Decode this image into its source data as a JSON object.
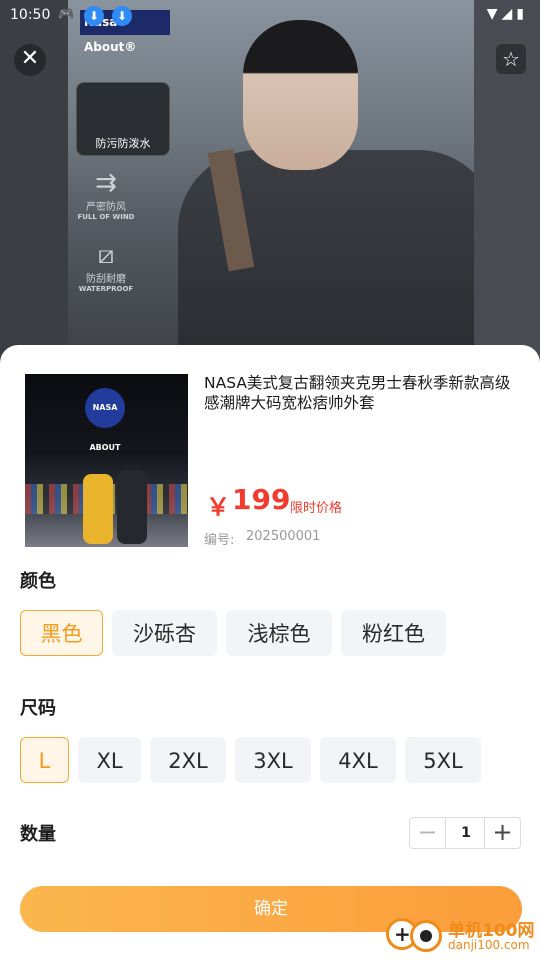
{
  "status_bar": {
    "time": "10:50",
    "right_icons": "▼◢▮"
  },
  "background": {
    "logo_text": "Nasa About®",
    "feature_card": "防污防泼水",
    "features": [
      {
        "icon": "wind-icon",
        "cn": "严密防风",
        "en": "FULL OF WIND"
      },
      {
        "icon": "scratch-icon",
        "cn": "防刮耐磨",
        "en": "WATERPROOF"
      }
    ]
  },
  "product": {
    "thumbnail_badge": "NASA ABOUT",
    "title": "NASA美式复古翻领夹克男士春秋季新款高级感潮牌大码宽松痞帅外套",
    "price_symbol": "￥",
    "price": "199",
    "price_tag": "限时价格",
    "code_label": "编号:",
    "code_value": "202500001"
  },
  "color_section": {
    "title": "颜色",
    "options": [
      "黑色",
      "沙砾杏",
      "浅棕色",
      "粉红色"
    ],
    "selected": "黑色"
  },
  "size_section": {
    "title": "尺码",
    "options": [
      "L",
      "XL",
      "2XL",
      "3XL",
      "4XL",
      "5XL"
    ],
    "selected": "L"
  },
  "quantity_section": {
    "title": "数量",
    "value": "1",
    "minus": "−",
    "plus": "+"
  },
  "confirm_button": "确定",
  "watermark": {
    "line1": "单机100网",
    "line2": "danji100.com"
  },
  "colors": {
    "accent": "#f7a734",
    "price": "#f23b2d",
    "chip_bg": "#f2f4f7"
  }
}
